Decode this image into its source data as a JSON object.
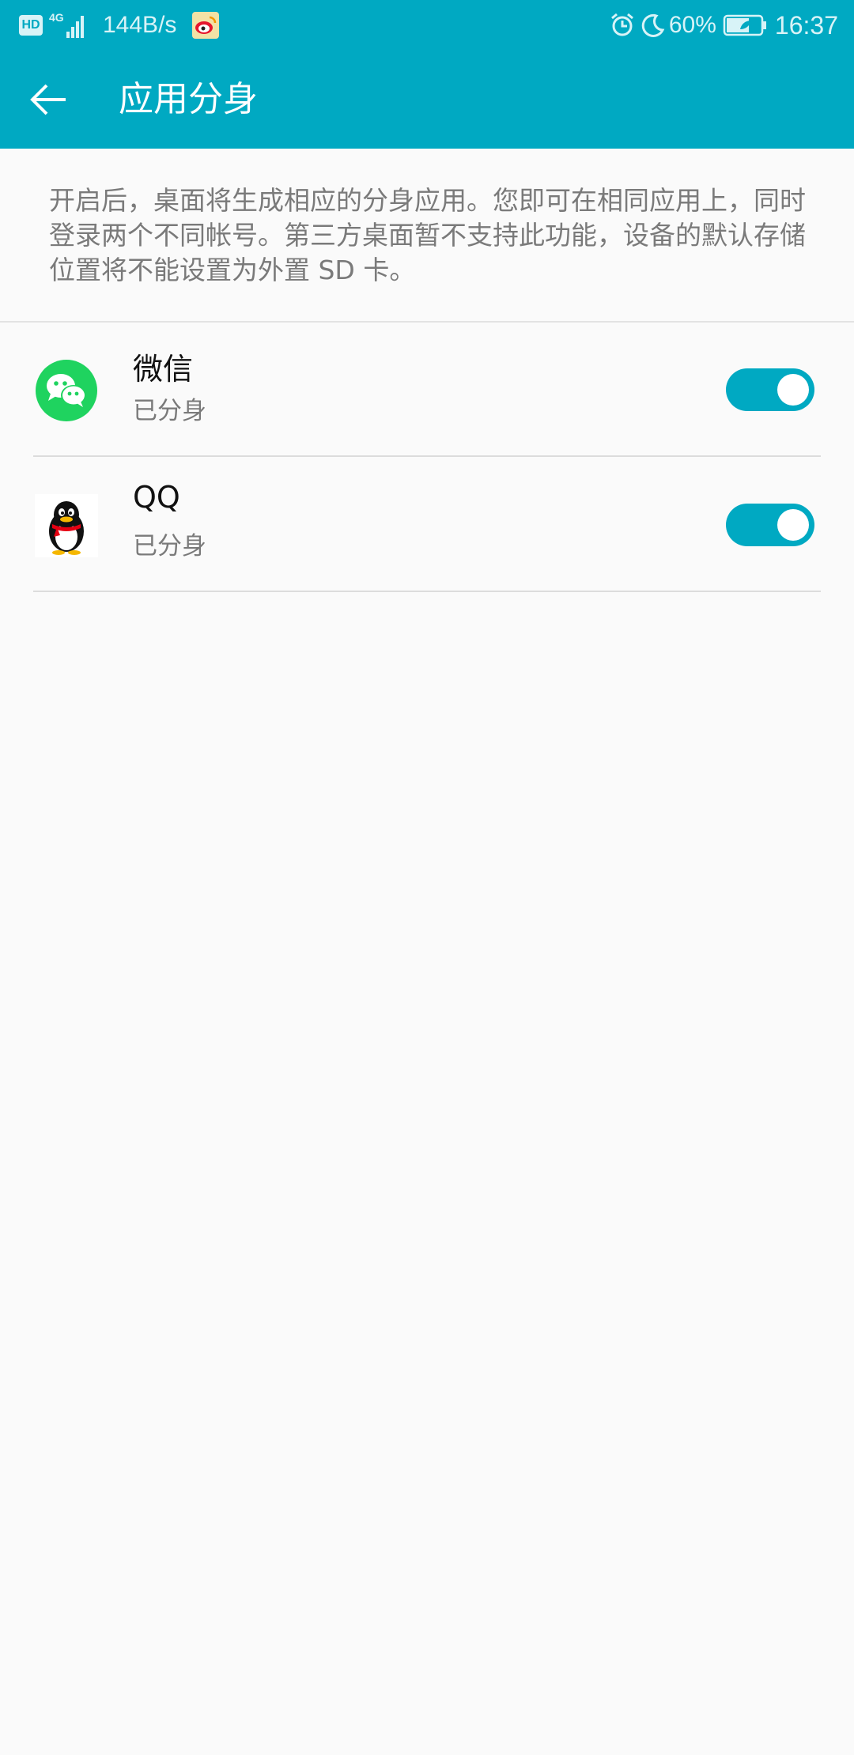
{
  "status_bar": {
    "hd_label": "HD",
    "network_label": "4G",
    "speed": "144B/s",
    "battery": "60%",
    "time": "16:37"
  },
  "app_bar": {
    "title": "应用分身"
  },
  "description": "开启后，桌面将生成相应的分身应用。您即可在相同应用上，同时登录两个不同帐号。第三方桌面暂不支持此功能，设备的默认存储位置将不能设置为外置 SD 卡。",
  "apps": [
    {
      "name": "微信",
      "status": "已分身",
      "enabled": true,
      "icon": "wechat-icon"
    },
    {
      "name": "QQ",
      "status": "已分身",
      "enabled": true,
      "icon": "qq-penguin-icon"
    }
  ],
  "colors": {
    "accent": "#00a9c2",
    "background": "#fafafa",
    "secondary_text": "#7a7a7a",
    "wechat_green": "#1fd35f"
  }
}
